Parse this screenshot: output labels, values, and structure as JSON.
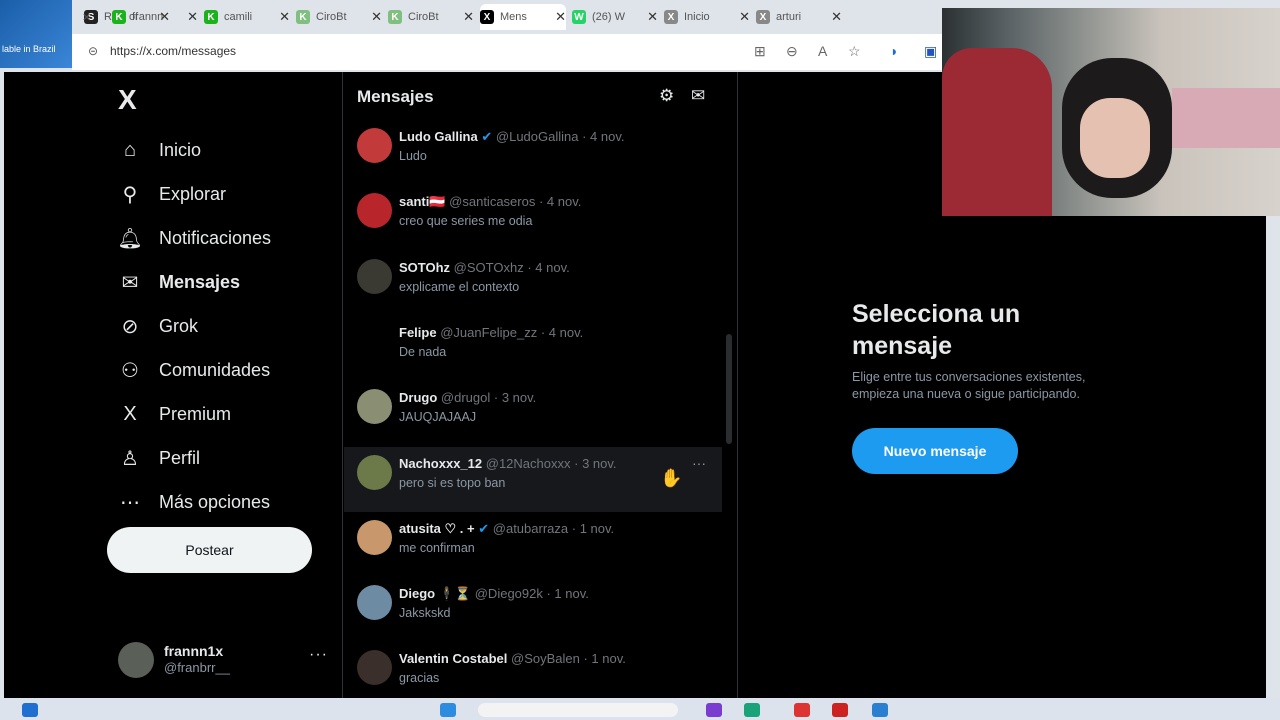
{
  "browser": {
    "left_banner": "lable in Brazil",
    "tabs": [
      {
        "label": "Rise of",
        "fav": "S",
        "fav_color": "#222222"
      },
      {
        "label": "frannn",
        "fav": "K",
        "fav_color": "#1bb31b"
      },
      {
        "label": "camili",
        "fav": "K",
        "fav_color": "#1bb31b"
      },
      {
        "label": "CiroBt",
        "fav": "K",
        "fav_color": "#7fbf7f"
      },
      {
        "label": "CiroBt",
        "fav": "K",
        "fav_color": "#7fbf7f"
      },
      {
        "label": "Mens",
        "fav": "X",
        "fav_color": "#000000"
      },
      {
        "label": "(26) W",
        "fav": "W",
        "fav_color": "#25d366"
      },
      {
        "label": "Inicio",
        "fav": "X",
        "fav_color": "#888888"
      },
      {
        "label": "arturi",
        "fav": "X",
        "fav_color": "#888888"
      }
    ],
    "url": "https://x.com/messages"
  },
  "sidebar": {
    "logo": "X",
    "items": [
      {
        "label": "Inicio",
        "icon": "home-icon",
        "glyph": "⌂"
      },
      {
        "label": "Explorar",
        "icon": "search-icon",
        "glyph": "⚲"
      },
      {
        "label": "Notificaciones",
        "icon": "bell-icon",
        "glyph": "🔔︎"
      },
      {
        "label": "Mensajes",
        "icon": "envelope-icon",
        "glyph": "✉"
      },
      {
        "label": "Grok",
        "icon": "grok-icon",
        "glyph": "⊘"
      },
      {
        "label": "Comunidades",
        "icon": "communities-icon",
        "glyph": "⚇"
      },
      {
        "label": "Premium",
        "icon": "premium-x-icon",
        "glyph": "X"
      },
      {
        "label": "Perfil",
        "icon": "person-icon",
        "glyph": "♙"
      },
      {
        "label": "Más opciones",
        "icon": "more-circle-icon",
        "glyph": "⋯"
      }
    ],
    "post_label": "Postear",
    "user": {
      "name": "frannn1x",
      "handle": "@franbrr__",
      "more": "···"
    }
  },
  "messages": {
    "title": "Mensajes",
    "conversations": [
      {
        "name": "Ludo Gallina",
        "verified": true,
        "handle": "@LudoGallina",
        "date": "4 nov.",
        "preview": "Ludo",
        "avatar_color": "#c23a3a"
      },
      {
        "name": "santi🇦🇹",
        "verified": false,
        "handle": "@santicaseros",
        "date": "4 nov.",
        "preview": "creo que series me odia",
        "avatar_color": "#b8262b"
      },
      {
        "name": "SOTOhz",
        "verified": false,
        "handle": "@SOTOxhz",
        "date": "4 nov.",
        "preview": "explicame el contexto",
        "avatar_color": "#3a3a32"
      },
      {
        "name": "Felipe",
        "verified": false,
        "handle": "@JuanFelipe_zz",
        "date": "4 nov.",
        "preview": "De nada",
        "avatar_color": "#000000"
      },
      {
        "name": "Drugo",
        "verified": false,
        "handle": "@drugol",
        "date": "3 nov.",
        "preview": "JAUQJAJAAJ",
        "avatar_color": "#8a8f74"
      },
      {
        "name": "Nachoxxx_12",
        "verified": false,
        "handle": "@12Nachoxxx",
        "date": "3 nov.",
        "preview": "pero si es topo ban",
        "avatar_color": "#6c7a4a"
      },
      {
        "name": "atusita ♡ . +",
        "verified": true,
        "handle": "@atubarraza",
        "date": "1 nov.",
        "preview": "me confirman",
        "avatar_color": "#c8976b"
      },
      {
        "name": "Diego 🕴⏳",
        "verified": false,
        "handle": "@Diego92k",
        "date": "1 nov.",
        "preview": "Jakskskd",
        "avatar_color": "#6d8ba3"
      },
      {
        "name": "Valentin Costabel",
        "verified": false,
        "handle": "@SoyBalen",
        "date": "1 nov.",
        "preview": "gracias",
        "avatar_color": "#3a2f2a"
      }
    ]
  },
  "empty_state": {
    "title": "Selecciona un mensaje",
    "subtitle": "Elige entre tus conversaciones existentes, empieza una nueva o sigue participando.",
    "button": "Nuevo mensaje"
  }
}
